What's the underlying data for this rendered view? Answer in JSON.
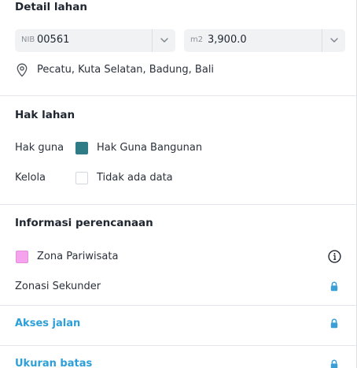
{
  "land_detail": {
    "title": "Detail lahan",
    "nib_prefix": "NIB",
    "nib_value": "00561",
    "area_unit": "m2",
    "area_value": "3,900.0",
    "location_text": "Pecatu, Kuta Selatan, Badung, Bali"
  },
  "land_rights": {
    "title": "Hak lahan",
    "rows": [
      {
        "label": "Hak guna",
        "value": "Hak Guna Bangunan",
        "swatch_color": "#2f7b86"
      },
      {
        "label": "Kelola",
        "value": "Tidak ada data",
        "swatch_color": "#ffffff"
      }
    ]
  },
  "planning": {
    "title": "Informasi perencanaan",
    "zone_label": "Zona Pariwisata",
    "zone_color": "#f4a3ec",
    "secondary_label": "Zonasi Sekunder"
  },
  "road_access": {
    "label": "Akses jalan"
  },
  "boundary_size": {
    "label": "Ukuran batas"
  },
  "colors": {
    "accent": "#2d9fd8",
    "lock": "#3a9fd6"
  },
  "icons": {
    "location": "map-pin-icon",
    "caret": "chevron-down-icon",
    "info": "info-circle-icon",
    "lock": "lock-icon"
  }
}
